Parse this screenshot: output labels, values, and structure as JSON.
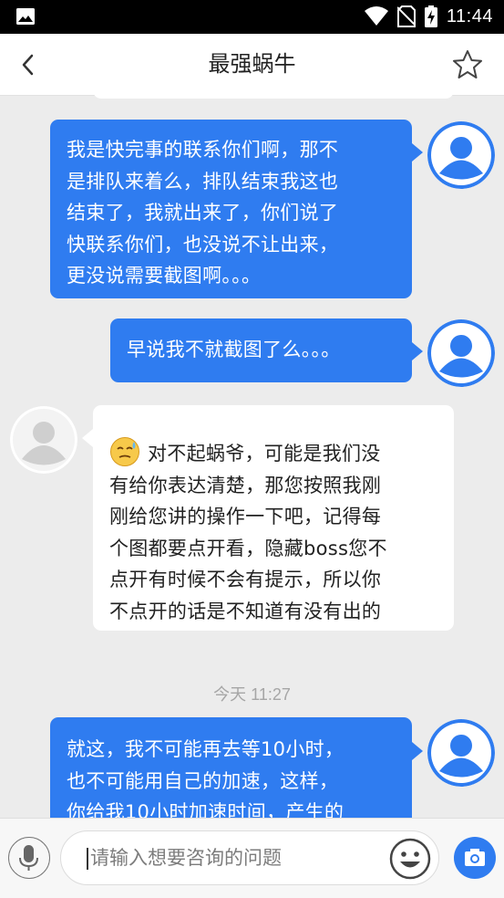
{
  "status_bar": {
    "time": "11:44"
  },
  "header": {
    "title": "最强蜗牛"
  },
  "messages": [
    {
      "side": "right",
      "lines": [
        "我是快完事的联系你们啊，那不",
        "是排队来着么，排队结束我这也",
        "结束了，我就出来了，你们说了",
        "快联系你们，也没说不让出来，",
        "更没说需要截图啊。。。"
      ]
    },
    {
      "side": "right",
      "lines": [
        "早说我不就截图了么。。。"
      ]
    },
    {
      "side": "left",
      "lines": [
        "对不起蜗爷，可能是我们没",
        "有给你表达清楚，那您按照我刚",
        "刚给您讲的操作一下吧，记得每",
        "个图都要点开看，隐藏boss您不",
        "点开有时候不会有提示，所以你",
        "不点开的话是不知道有没有出的"
      ]
    },
    {
      "side": "right",
      "lines": [
        "就这，我不可能再去等10小时，",
        "也不可能用自己的加速，这样，",
        "你给我10小时加速时间，产生的"
      ]
    }
  ],
  "timestamp": "今天 11:27",
  "input": {
    "placeholder": "请输入想要咨询的问题"
  },
  "colors": {
    "accent": "#2f7cf0",
    "background": "#ececec"
  }
}
